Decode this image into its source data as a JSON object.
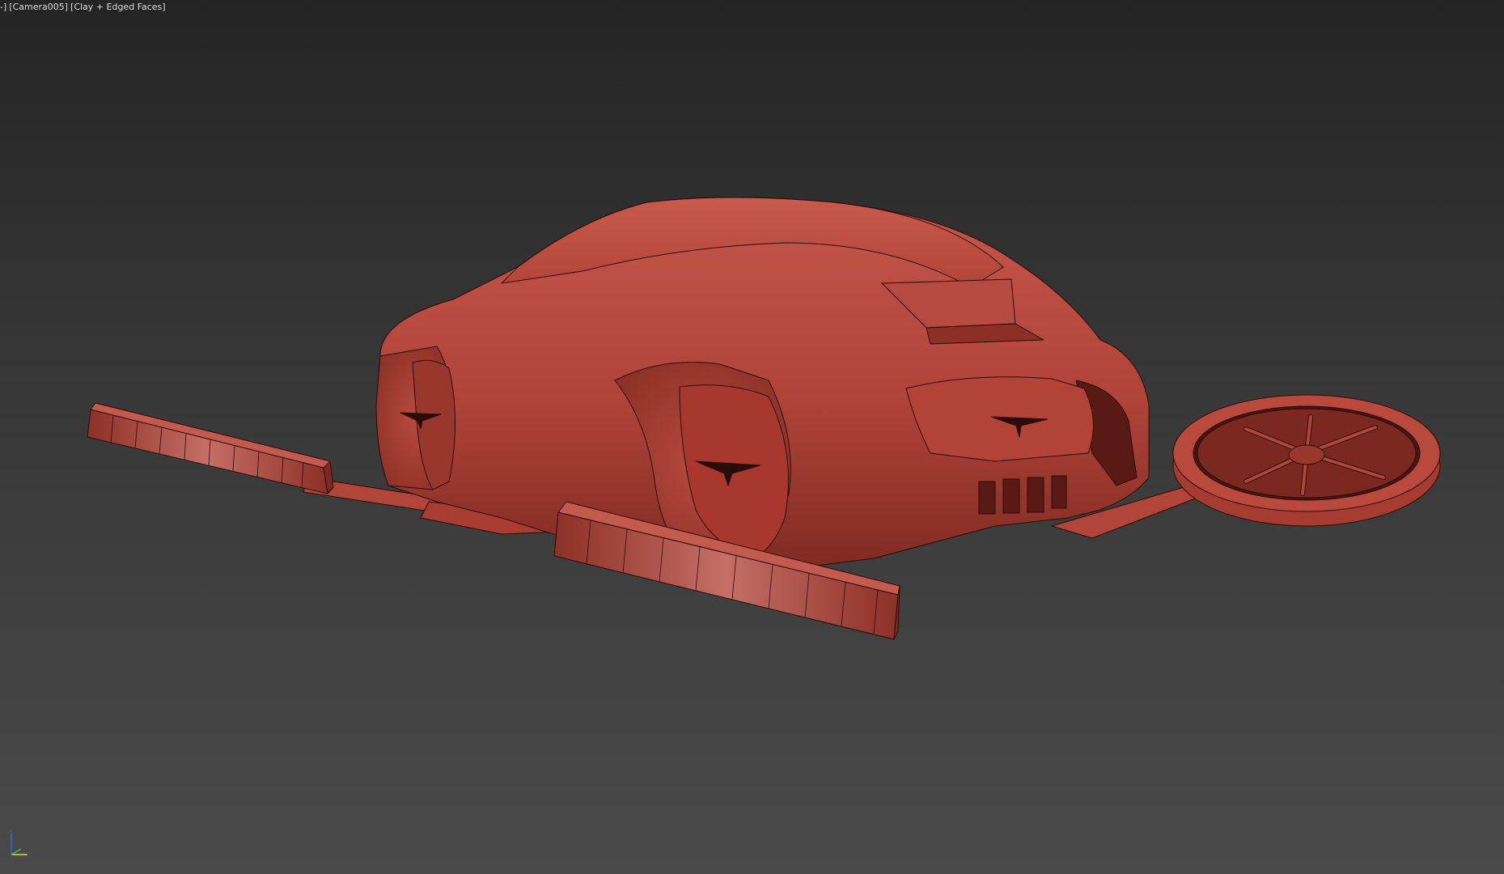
{
  "viewport": {
    "label_prefix": "-",
    "camera": "[Camera005]",
    "shading": "[Clay + Edged Faces]",
    "prefix_bracket": "]",
    "background_top": "#242424",
    "background_bottom": "#4a4a4a"
  },
  "model": {
    "name": "flying-car-model",
    "clay_color": "#b8473c",
    "clay_dark": "#7a2a22",
    "edge_color": "#2a0c08"
  },
  "gizmo": {
    "axes": [
      "x",
      "y",
      "z"
    ],
    "colors": {
      "x": "#d9d93a",
      "y": "#3ec23e",
      "z": "#3a63d9"
    }
  }
}
